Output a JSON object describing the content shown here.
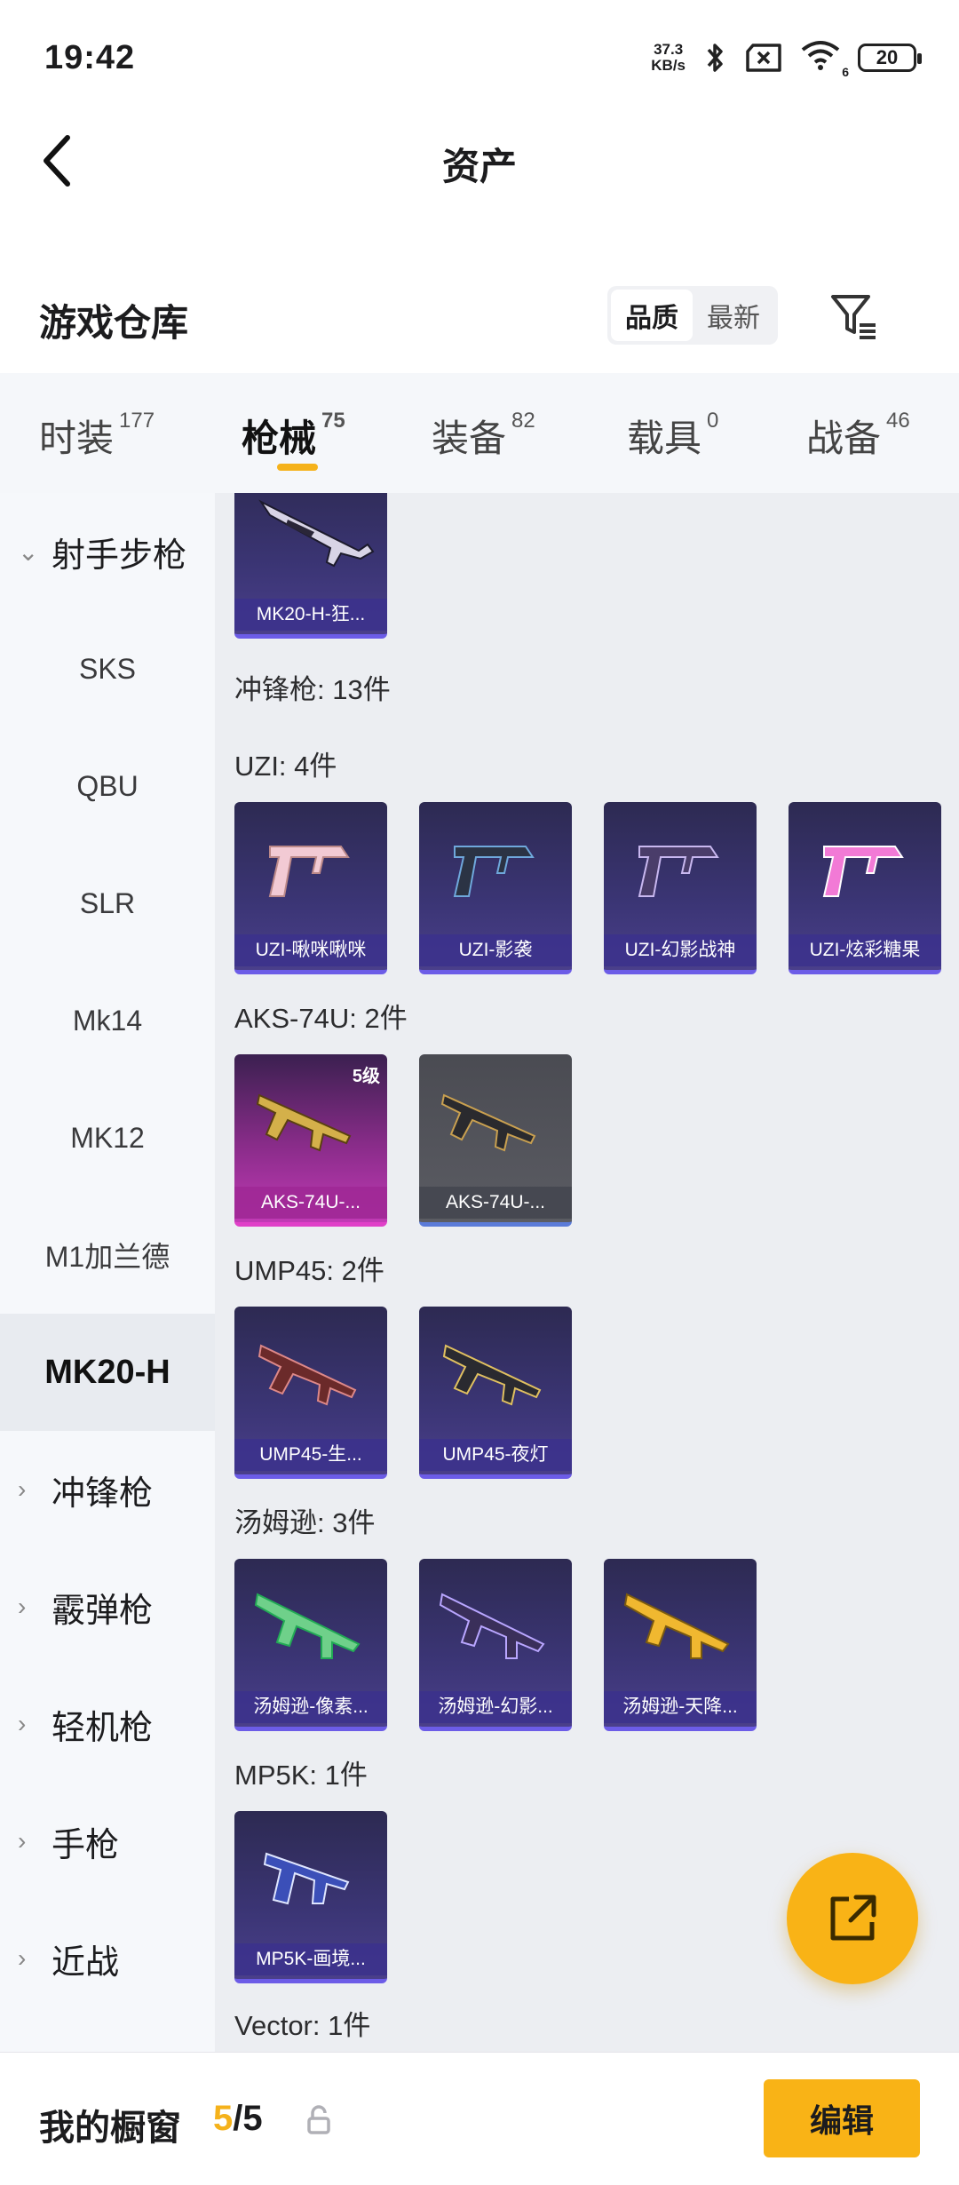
{
  "status_bar": {
    "time": "19:42",
    "net_speed_value": "37.3",
    "net_speed_unit": "KB/s",
    "wifi_num": "6",
    "battery": "20"
  },
  "nav": {
    "title": "资产"
  },
  "warehouse": {
    "title": "游戏仓库",
    "sort_options": [
      "品质",
      "最新"
    ]
  },
  "tabs": [
    {
      "label": "时装",
      "count": "177"
    },
    {
      "label": "枪械",
      "count": "75"
    },
    {
      "label": "装备",
      "count": "82"
    },
    {
      "label": "载具",
      "count": "0"
    },
    {
      "label": "战备",
      "count": "46"
    }
  ],
  "sidebar": {
    "items": [
      {
        "label": "射手步枪",
        "type": "group",
        "expanded": true
      },
      {
        "label": "SKS"
      },
      {
        "label": "QBU"
      },
      {
        "label": "SLR"
      },
      {
        "label": "Mk14"
      },
      {
        "label": "MK12"
      },
      {
        "label": "M1加兰德"
      },
      {
        "label": "MK20-H",
        "selected": true
      },
      {
        "label": "冲锋枪",
        "type": "group"
      },
      {
        "label": "霰弹枪",
        "type": "group"
      },
      {
        "label": "轻机枪",
        "type": "group"
      },
      {
        "label": "手枪",
        "type": "group"
      },
      {
        "label": "近战",
        "type": "group"
      }
    ]
  },
  "content": {
    "top_card": "MK20-H-狂...",
    "smg_total": "冲锋枪: 13件",
    "uzi": {
      "label": "UZI: 4件",
      "items": [
        "UZI-啾咪啾咪",
        "UZI-影袭",
        "UZI-幻影战神",
        "UZI-炫彩糖果"
      ]
    },
    "aks": {
      "label": "AKS-74U: 2件",
      "items": [
        "AKS-74U-...",
        "AKS-74U-..."
      ],
      "level": "5级"
    },
    "ump": {
      "label": "UMP45: 2件",
      "items": [
        "UMP45-生...",
        "UMP45-夜灯"
      ]
    },
    "tommy": {
      "label": "汤姆逊: 3件",
      "items": [
        "汤姆逊-像素...",
        "汤姆逊-幻影...",
        "汤姆逊-天降..."
      ]
    },
    "mp5k": {
      "label": "MP5K: 1件",
      "items": [
        "MP5K-画境..."
      ]
    },
    "vector": {
      "label": "Vector: 1件"
    }
  },
  "bottom": {
    "showcase_label": "我的橱窗",
    "current": "5",
    "separator_total": "/5",
    "edit_label": "编辑"
  },
  "colors": {
    "accent": "#f9b316",
    "card_purple": "#3b3575",
    "card_pink": "#c13ab5",
    "card_grey": "#5b5c63"
  }
}
